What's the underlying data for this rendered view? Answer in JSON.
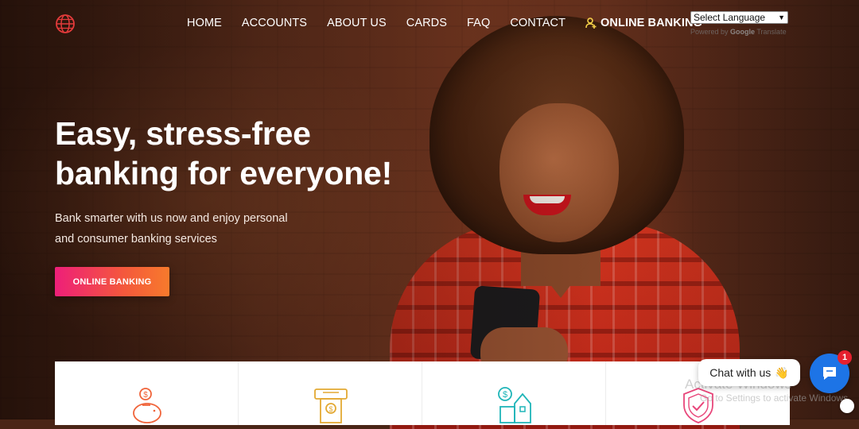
{
  "nav": {
    "items": [
      "HOME",
      "ACCOUNTS",
      "ABOUT US",
      "CARDS",
      "FAQ",
      "CONTACT"
    ],
    "online_banking": "ONLINE BANKING"
  },
  "language": {
    "selected": "Select Language",
    "powered_by": "Powered by",
    "google": "Google",
    "translate": "Translate"
  },
  "hero": {
    "title_line1": "Easy, stress-free",
    "title_line2": "banking for everyone!",
    "subtitle_line1": "Bank smarter with us now and enjoy personal",
    "subtitle_line2": "and consumer banking services",
    "cta": "ONLINE BANKING"
  },
  "cards": {
    "icons": [
      "piggy-bank-icon",
      "atm-icon",
      "money-house-icon",
      "shield-check-icon"
    ]
  },
  "chat": {
    "bubble": "Chat with us",
    "badge": "1"
  },
  "watermark": {
    "line1": "Activate Windows",
    "line2": "Go to Settings to activate Windows."
  },
  "colors": {
    "accent_gradient_start": "#ee1f79",
    "accent_gradient_end": "#f77a2c",
    "chat_blue": "#1d74e6",
    "icon_orange": "#f0643a",
    "icon_gold": "#e3a933",
    "icon_teal": "#1fb5b8",
    "icon_pink": "#e8467a"
  }
}
